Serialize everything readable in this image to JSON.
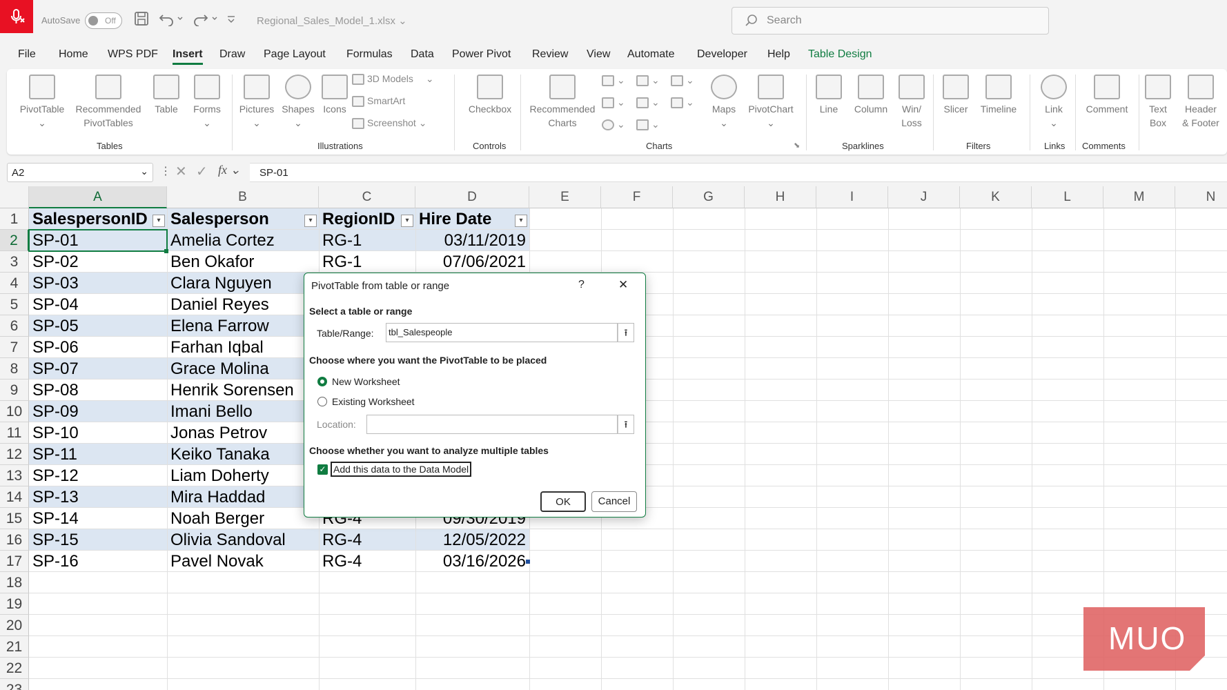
{
  "app": {
    "autosave_label": "AutoSave",
    "autosave_state": "Off",
    "filename": "Regional_Sales_Model_1.xlsx",
    "search_placeholder": "Search"
  },
  "menu": [
    "File",
    "Home",
    "WPS PDF",
    "Insert",
    "Draw",
    "Page Layout",
    "Formulas",
    "Data",
    "Power Pivot",
    "Review",
    "View",
    "Automate",
    "Developer",
    "Help",
    "Table Design"
  ],
  "ribbon": {
    "pivottable": "PivotTable",
    "recommended_pivot_1": "Recommended",
    "recommended_pivot_2": "PivotTables",
    "table": "Table",
    "forms": "Forms",
    "group_tables": "Tables",
    "pictures": "Pictures",
    "shapes": "Shapes",
    "icons": "Icons",
    "models3d": "3D Models",
    "smartart": "SmartArt",
    "screenshot": "Screenshot",
    "group_illustrations": "Illustrations",
    "checkbox": "Checkbox",
    "group_controls": "Controls",
    "rec_charts_1": "Recommended",
    "rec_charts_2": "Charts",
    "maps": "Maps",
    "pivotchart": "PivotChart",
    "group_charts": "Charts",
    "line": "Line",
    "column": "Column",
    "winloss_1": "Win/",
    "winloss_2": "Loss",
    "group_sparklines": "Sparklines",
    "slicer": "Slicer",
    "timeline": "Timeline",
    "group_filters": "Filters",
    "link": "Link",
    "group_links": "Links",
    "comment": "Comment",
    "group_comments": "Comments",
    "textbox_1": "Text",
    "textbox_2": "Box",
    "header_1": "Header",
    "header_2": "& Footer"
  },
  "formula_bar": {
    "name_box": "A2",
    "formula": "SP-01"
  },
  "columns": [
    "A",
    "B",
    "C",
    "D",
    "E",
    "F",
    "G",
    "H",
    "I",
    "J",
    "K",
    "L",
    "M",
    "N"
  ],
  "rows": [
    "1",
    "2",
    "3",
    "4",
    "5",
    "6",
    "7",
    "8",
    "9",
    "10",
    "11",
    "12",
    "13",
    "14",
    "15",
    "16",
    "17",
    "18",
    "19",
    "20",
    "21",
    "22",
    "23"
  ],
  "table": {
    "headers": [
      "SalespersonID",
      "Salesperson",
      "RegionID",
      "Hire Date"
    ],
    "rows": [
      [
        "SP-01",
        "Amelia Cortez",
        "RG-1",
        "03/11/2019"
      ],
      [
        "SP-02",
        "Ben Okafor",
        "RG-1",
        "07/06/2021"
      ],
      [
        "SP-03",
        "Clara Nguyen",
        "",
        ""
      ],
      [
        "SP-04",
        "Daniel Reyes",
        "",
        ""
      ],
      [
        "SP-05",
        "Elena Farrow",
        "",
        ""
      ],
      [
        "SP-06",
        "Farhan Iqbal",
        "",
        ""
      ],
      [
        "SP-07",
        "Grace Molina",
        "",
        ""
      ],
      [
        "SP-08",
        "Henrik Sorensen",
        "",
        ""
      ],
      [
        "SP-09",
        "Imani Bello",
        "",
        ""
      ],
      [
        "SP-10",
        "Jonas Petrov",
        "",
        ""
      ],
      [
        "SP-11",
        "Keiko Tanaka",
        "",
        ""
      ],
      [
        "SP-12",
        "Liam Doherty",
        "",
        ""
      ],
      [
        "SP-13",
        "Mira Haddad",
        "",
        ""
      ],
      [
        "SP-14",
        "Noah Berger",
        "RG-4",
        "09/30/2019"
      ],
      [
        "SP-15",
        "Olivia Sandoval",
        "RG-4",
        "12/05/2022"
      ],
      [
        "SP-16",
        "Pavel Novak",
        "RG-4",
        "03/16/2026"
      ]
    ]
  },
  "dialog": {
    "title": "PivotTable from table or range",
    "help": "?",
    "close": "✕",
    "section1": "Select a table or range",
    "table_range_label": "Table/Range:",
    "table_range_value": "tbl_Salespeople",
    "section2": "Choose where you want the PivotTable to be placed",
    "opt_new": "New Worksheet",
    "opt_existing": "Existing Worksheet",
    "location_label": "Location:",
    "location_value": "",
    "section3": "Choose whether you want to analyze multiple tables",
    "add_data_model": "Add this data to the Data Model",
    "ok": "OK",
    "cancel": "Cancel"
  },
  "watermark": "MUO",
  "colors": {
    "accent": "#107c41",
    "table_band": "#dce6f2",
    "mic": "#e81123",
    "watermark": "#e06666"
  }
}
